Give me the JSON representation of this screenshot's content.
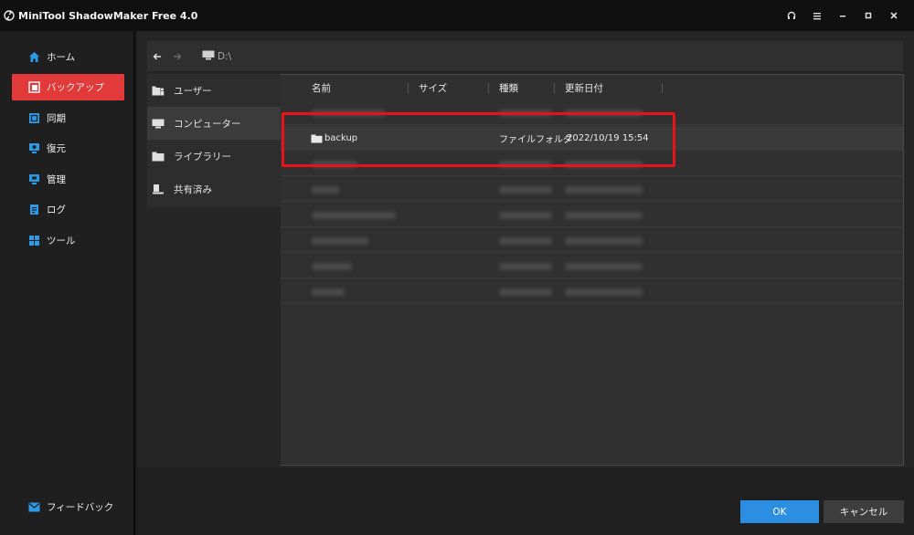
{
  "app": {
    "title": "MiniTool ShadowMaker Free 4.0"
  },
  "sidebar": {
    "items": [
      {
        "label": "ホーム",
        "icon": "home-icon",
        "active": false
      },
      {
        "label": "バックアップ",
        "icon": "backup-icon",
        "active": true
      },
      {
        "label": "同期",
        "icon": "sync-icon",
        "active": false
      },
      {
        "label": "復元",
        "icon": "restore-icon",
        "active": false
      },
      {
        "label": "管理",
        "icon": "manage-icon",
        "active": false
      },
      {
        "label": "ログ",
        "icon": "log-icon",
        "active": false
      },
      {
        "label": "ツール",
        "icon": "tools-icon",
        "active": false
      }
    ],
    "feedback_label": "フィードバック"
  },
  "pathbar": {
    "path": "D:\\"
  },
  "locations": [
    {
      "label": "ユーザー",
      "icon": "user-folder-icon"
    },
    {
      "label": "コンピューター",
      "icon": "computer-icon"
    },
    {
      "label": "ライブラリー",
      "icon": "library-icon"
    },
    {
      "label": "共有済み",
      "icon": "shared-icon"
    }
  ],
  "filelist": {
    "columns": {
      "name": "名前",
      "size": "サイズ",
      "type": "種類",
      "modified": "更新日付"
    },
    "highlighted_row": {
      "name": "backup",
      "size": "",
      "type": "ファイルフォルダ",
      "modified": "2022/10/19 15:54"
    }
  },
  "buttons": {
    "ok": "OK",
    "cancel": "キャンセル"
  },
  "colors": {
    "accent_red": "#e23a3a",
    "ok_blue": "#2b8ee0",
    "highlight_red": "#e8121a",
    "icon_blue": "#2b9be8"
  }
}
